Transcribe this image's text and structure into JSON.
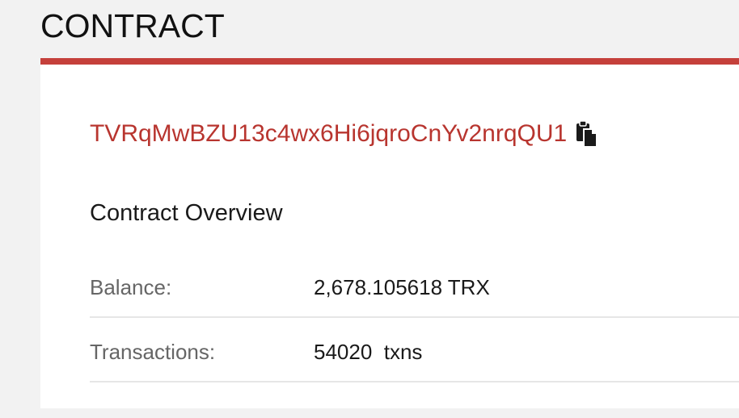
{
  "header": {
    "title": "CONTRACT"
  },
  "contract": {
    "address": "TVRqMwBZU13c4wx6Hi6jqroCnYv2nrqQU1",
    "copy_icon": "clipboard-icon",
    "overview_title": "Contract Overview",
    "rows": [
      {
        "label": "Balance:",
        "value": "2,678.105618 TRX"
      },
      {
        "label": "Transactions:",
        "value": "54020  txns"
      }
    ]
  },
  "colors": {
    "accent": "#c5403b",
    "address_text": "#b8352f",
    "background": "#f2f2f2",
    "card": "#ffffff",
    "label_text": "#666666"
  }
}
